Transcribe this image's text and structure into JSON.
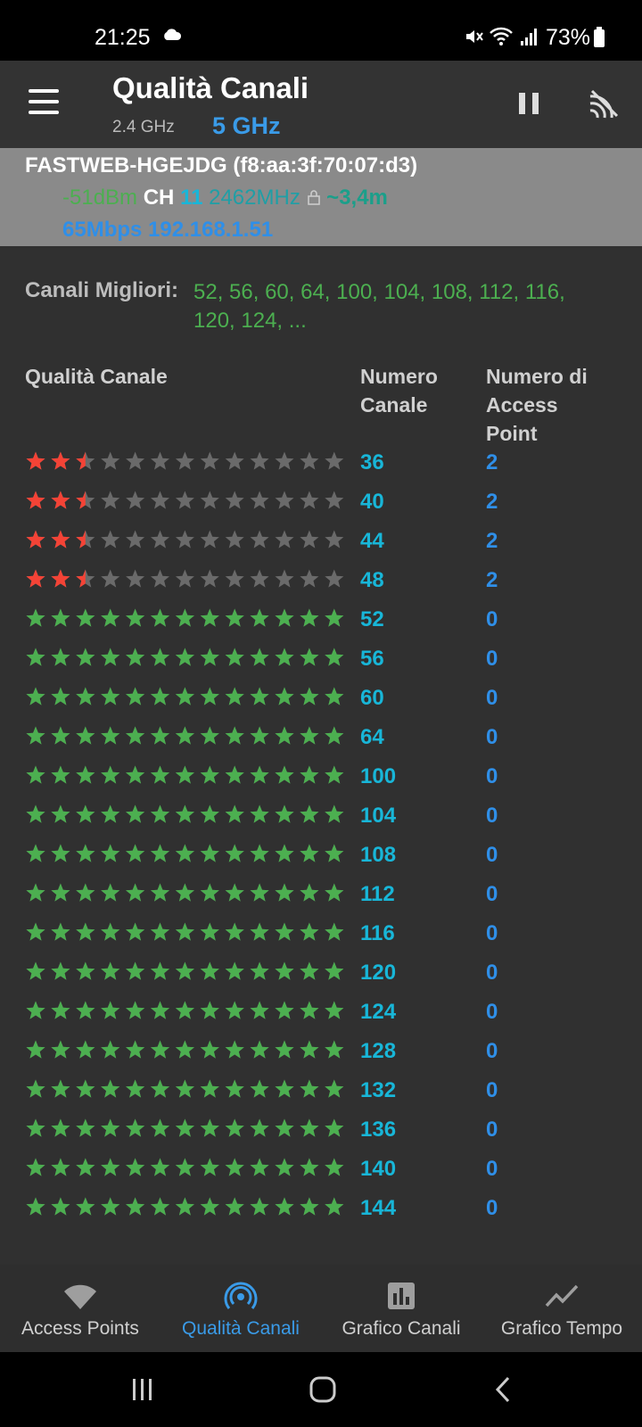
{
  "status_bar": {
    "time": "21:25",
    "battery": "73%"
  },
  "app_bar": {
    "title": "Qualità Canali",
    "band_24": "2.4 GHz",
    "band_5": "5 GHz"
  },
  "connected_ap": {
    "ssid_line": "FASTWEB-HGEJDG (f8:aa:3f:70:07:d3)",
    "signal": "-51dBm",
    "ch_label": "CH",
    "ch_value": "11",
    "frequency": "2462MHz",
    "distance": "~3,4m",
    "speed": "65Mbps",
    "ip": "192.168.1.51"
  },
  "best_channels": {
    "label": "Canali Migliori:",
    "values": "52, 56, 60, 64, 100, 104, 108, 112, 116, 120, 124, ..."
  },
  "table": {
    "col_quality": "Qualità Canale",
    "col_channel": "Numero Canale",
    "col_aps": "Numero di Access Point",
    "total_stars": 13,
    "rows": [
      {
        "channel": "36",
        "aps": "2",
        "rating": 2.5
      },
      {
        "channel": "40",
        "aps": "2",
        "rating": 2.5
      },
      {
        "channel": "44",
        "aps": "2",
        "rating": 2.5
      },
      {
        "channel": "48",
        "aps": "2",
        "rating": 2.5
      },
      {
        "channel": "52",
        "aps": "0",
        "rating": 13
      },
      {
        "channel": "56",
        "aps": "0",
        "rating": 13
      },
      {
        "channel": "60",
        "aps": "0",
        "rating": 13
      },
      {
        "channel": "64",
        "aps": "0",
        "rating": 13
      },
      {
        "channel": "100",
        "aps": "0",
        "rating": 13
      },
      {
        "channel": "104",
        "aps": "0",
        "rating": 13
      },
      {
        "channel": "108",
        "aps": "0",
        "rating": 13
      },
      {
        "channel": "112",
        "aps": "0",
        "rating": 13
      },
      {
        "channel": "116",
        "aps": "0",
        "rating": 13
      },
      {
        "channel": "120",
        "aps": "0",
        "rating": 13
      },
      {
        "channel": "124",
        "aps": "0",
        "rating": 13
      },
      {
        "channel": "128",
        "aps": "0",
        "rating": 13
      },
      {
        "channel": "132",
        "aps": "0",
        "rating": 13
      },
      {
        "channel": "136",
        "aps": "0",
        "rating": 13
      },
      {
        "channel": "140",
        "aps": "0",
        "rating": 13
      },
      {
        "channel": "144",
        "aps": "0",
        "rating": 13
      }
    ]
  },
  "colors": {
    "star_good": "#4caf50",
    "star_bad": "#f44336",
    "star_empty": "#6a6a6a",
    "accent": "#3a9be8"
  },
  "bottom_nav": [
    {
      "label": "Access Points",
      "icon": "wifi-icon",
      "active": false
    },
    {
      "label": "Qualità Canali",
      "icon": "radar-icon",
      "active": true
    },
    {
      "label": "Grafico Canali",
      "icon": "bar-chart-icon",
      "active": false
    },
    {
      "label": "Grafico Tempo",
      "icon": "line-chart-icon",
      "active": false
    }
  ]
}
